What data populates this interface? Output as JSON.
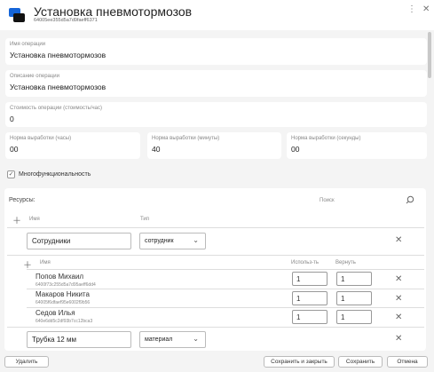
{
  "header": {
    "title": "Установка пневмотормозов",
    "id": "64005ee355d5a7d9faeff6371"
  },
  "fields": {
    "name": {
      "label": "Имя операции",
      "value": "Установка пневмотормозов"
    },
    "description": {
      "label": "Описание операции",
      "value": "Установка пневмотормозов"
    },
    "cost": {
      "label": "Стоимость операции (стоимость/час)",
      "value": "0"
    },
    "norm_hours": {
      "label": "Норма выработки (часы)",
      "value": "00"
    },
    "norm_minutes": {
      "label": "Норма выработки (минуты)",
      "value": "40"
    },
    "norm_seconds": {
      "label": "Норма выработки (секунды)",
      "value": "00"
    }
  },
  "multifunctional": {
    "label": "Многофункциональность",
    "checked": true
  },
  "resources": {
    "title": "Ресурсы:",
    "search_placeholder": "Поиск",
    "columns": {
      "name": "Имя",
      "type": "Тип"
    },
    "groups": [
      {
        "name": "Сотрудники",
        "type": "сотрудник",
        "columns": {
          "name": "Имя",
          "use": "Использ-ть",
          "return": "Вернуть"
        },
        "items": [
          {
            "name": "Попов Михаил",
            "id": "6400f73c255d5a7d95aeff6dd4",
            "use": "1",
            "return": "1"
          },
          {
            "name": "Макаров Никита",
            "id": "64005f6dfaef95e6002f9b56",
            "use": "1",
            "return": "1"
          },
          {
            "name": "Седов Илья",
            "id": "640e6dd5c2df93b7cc12bca3",
            "use": "1",
            "return": "1"
          }
        ]
      },
      {
        "name": "Трубка 12 мм",
        "type": "материал"
      }
    ]
  },
  "footer": {
    "delete": "Удалить",
    "save_close": "Сохранить и закрыть",
    "save": "Сохранить",
    "cancel": "Отмена"
  }
}
